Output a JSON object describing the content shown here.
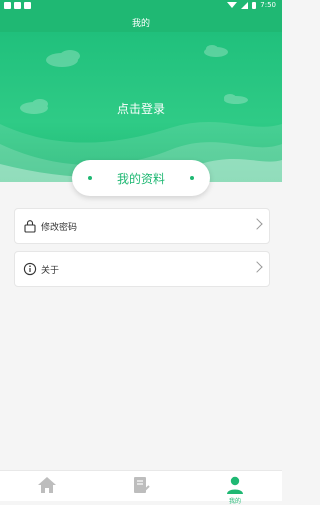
{
  "status": {
    "time": "7:50"
  },
  "header": {
    "title": "我的"
  },
  "hero": {
    "login_text": "点击登录"
  },
  "profile": {
    "label": "我的资料"
  },
  "menu": [
    {
      "label": "修改密码",
      "icon": "lock-icon"
    },
    {
      "label": "关于",
      "icon": "info-icon"
    }
  ],
  "tabs": [
    {
      "label": "",
      "icon": "home-icon",
      "active": false
    },
    {
      "label": "",
      "icon": "document-check-icon",
      "active": false
    },
    {
      "label": "我的",
      "icon": "user-icon",
      "active": true
    }
  ],
  "colors": {
    "accent": "#1fb873",
    "background": "#f5f5f5"
  }
}
